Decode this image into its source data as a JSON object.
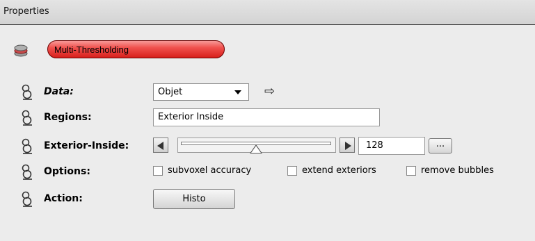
{
  "panel": {
    "title": "Properties"
  },
  "module": {
    "name": "Multi-Thresholding",
    "icon": "layers-icon"
  },
  "ports": {
    "data": {
      "label": "Data:",
      "value": "Objet",
      "connect_icon": "⇨"
    },
    "regions": {
      "label": "Regions:",
      "value": "Exterior Inside"
    },
    "exterior_inside": {
      "label": "Exterior-Inside:",
      "value": "128",
      "slider_fraction": 0.5,
      "more_label": "..."
    },
    "options": {
      "label": "Options:",
      "items": [
        {
          "label": "subvoxel accuracy",
          "checked": false
        },
        {
          "label": "extend exteriors",
          "checked": false
        },
        {
          "label": "remove bubbles",
          "checked": false
        }
      ]
    },
    "action": {
      "label": "Action:",
      "button": "Histo"
    }
  },
  "colors": {
    "module_button": "#e8342f",
    "panel_bg": "#ececec"
  }
}
